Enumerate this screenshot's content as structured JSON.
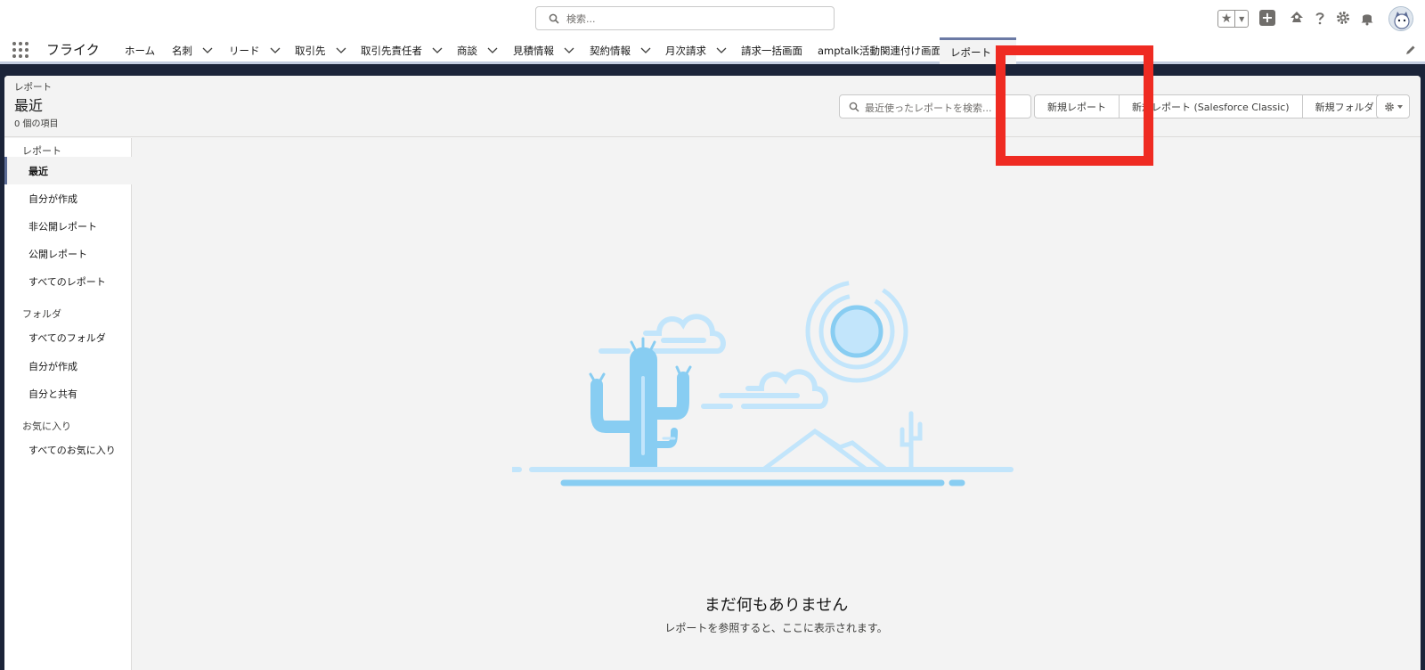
{
  "global_header": {
    "search_placeholder": "検索...",
    "icons": [
      "search-icon",
      "star-icon",
      "chevron-down-icon",
      "plus-icon",
      "trailhead-icon",
      "help-icon",
      "gear-icon",
      "bell-icon",
      "avatar"
    ]
  },
  "nav": {
    "app_name": "フライク",
    "items": [
      {
        "label": "ホーム",
        "has_menu": false
      },
      {
        "label": "名刺",
        "has_menu": true
      },
      {
        "label": "リード",
        "has_menu": true
      },
      {
        "label": "取引先",
        "has_menu": true
      },
      {
        "label": "取引先責任者",
        "has_menu": true
      },
      {
        "label": "商談",
        "has_menu": true
      },
      {
        "label": "見積情報",
        "has_menu": true
      },
      {
        "label": "契約情報",
        "has_menu": true
      },
      {
        "label": "月次請求",
        "has_menu": true
      },
      {
        "label": "請求一括画面",
        "has_menu": false
      },
      {
        "label": "amptalk活動関連付け画面",
        "has_menu": false
      },
      {
        "label": "レポート",
        "has_menu": false,
        "active": true
      }
    ]
  },
  "page_header": {
    "object_label": "レポート",
    "title": "最近",
    "item_count": "0 個の項目",
    "search_placeholder": "最近使ったレポートを検索...",
    "buttons": {
      "new_report": "新規レポート",
      "new_report_classic": "新規レポート (Salesforce Classic)",
      "new_folder": "新規フォルダ"
    }
  },
  "sidebar": {
    "sections": [
      {
        "title": "レポート",
        "items": [
          "最近",
          "自分が作成",
          "非公開レポート",
          "公開レポート",
          "すべてのレポート"
        ]
      },
      {
        "title": "フォルダ",
        "items": [
          "すべてのフォルダ",
          "自分が作成",
          "自分と共有"
        ]
      },
      {
        "title": "お気に入り",
        "items": [
          "すべてのお気に入り"
        ]
      }
    ],
    "active_item": "最近"
  },
  "empty_state": {
    "title": "まだ何もありません",
    "subtitle": "レポートを参照すると、ここに表示されます。"
  },
  "colors": {
    "nav_background": "#1b2439",
    "highlight": "#ef2b22",
    "illustration_light": "#c2e5fb",
    "illustration_dark": "#88cdf2"
  }
}
